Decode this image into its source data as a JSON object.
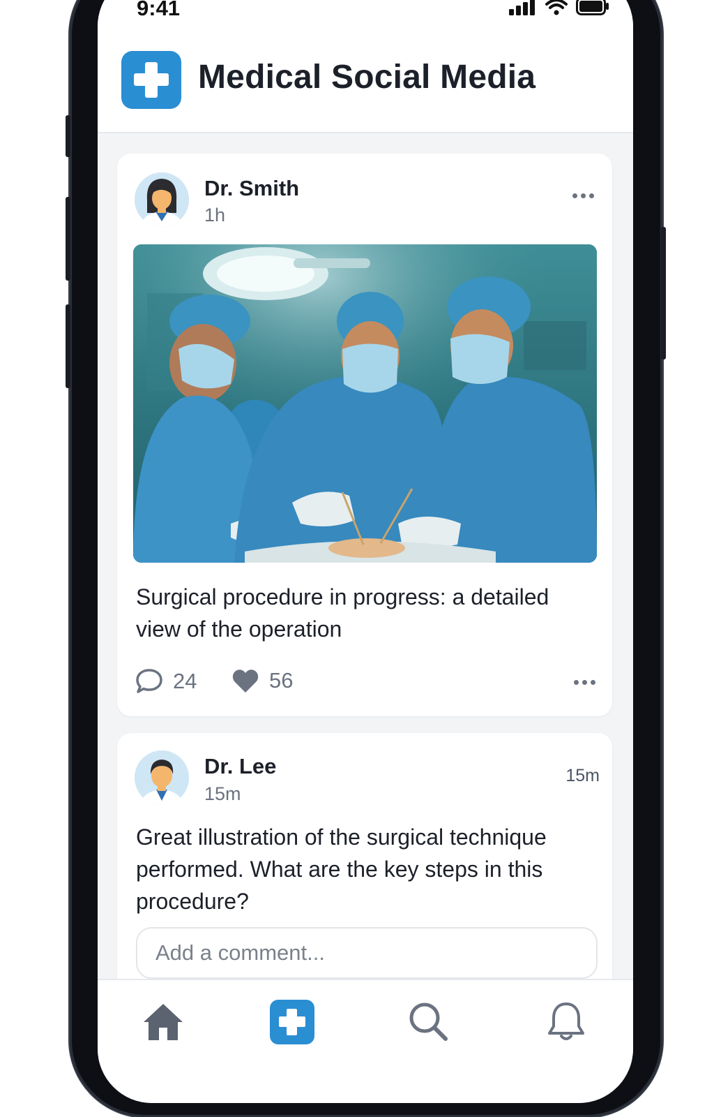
{
  "status_bar": {
    "time": "9:41"
  },
  "header": {
    "title": "Medical Social Media"
  },
  "post": {
    "author": "Dr. Smith",
    "time": "1h",
    "caption": "Surgical procedure in progress: a detailed view of the operation",
    "comment_count": "24",
    "like_count": "56",
    "image_icon": "surgery-photo"
  },
  "comment": {
    "author": "Dr. Lee",
    "time": "15m",
    "time_right": "15m",
    "text": "Great illustration of the surgical technique performed. What are the key steps in this procedure?",
    "input_placeholder": "Add a comment..."
  },
  "bottom_nav": {
    "items": [
      {
        "icon": "home-icon"
      },
      {
        "icon": "plus-icon"
      },
      {
        "icon": "search-icon"
      },
      {
        "icon": "bell-icon"
      }
    ]
  },
  "colors": {
    "accent": "#2a8ed3",
    "frame": "#0d0f14",
    "muted_text": "#6b7280"
  }
}
